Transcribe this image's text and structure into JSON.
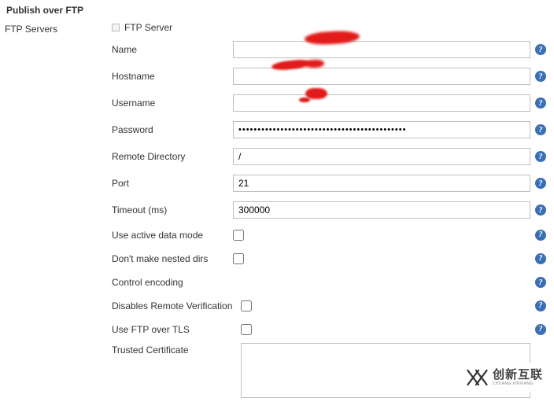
{
  "section_title": "Publish over FTP",
  "left_label": "FTP Servers",
  "group_title": "FTP Server",
  "fields": {
    "name": {
      "label": "Name",
      "value": ""
    },
    "hostname": {
      "label": "Hostname",
      "value": ""
    },
    "username": {
      "label": "Username",
      "value": ""
    },
    "password": {
      "label": "Password",
      "value": "••••••••••••••••••••••••••••••••••••••••••••"
    },
    "remote_dir": {
      "label": "Remote Directory",
      "value": "/"
    },
    "port": {
      "label": "Port",
      "value": "21"
    },
    "timeout": {
      "label": "Timeout (ms)",
      "value": "300000"
    },
    "active_mode": {
      "label": "Use active data mode",
      "checked": false
    },
    "no_nested": {
      "label": "Don't make nested dirs",
      "checked": false
    },
    "ctrl_enc": {
      "label": "Control encoding",
      "value": ""
    },
    "disable_rv": {
      "label": "Disables Remote Verification",
      "checked": false
    },
    "use_tls": {
      "label": "Use FTP over TLS",
      "checked": false
    },
    "trusted": {
      "label": "Trusted Certificate",
      "value": ""
    }
  },
  "help_tooltip": "?",
  "watermark": {
    "cn": "创新互联",
    "en": "CHUANG XINXIANG"
  }
}
